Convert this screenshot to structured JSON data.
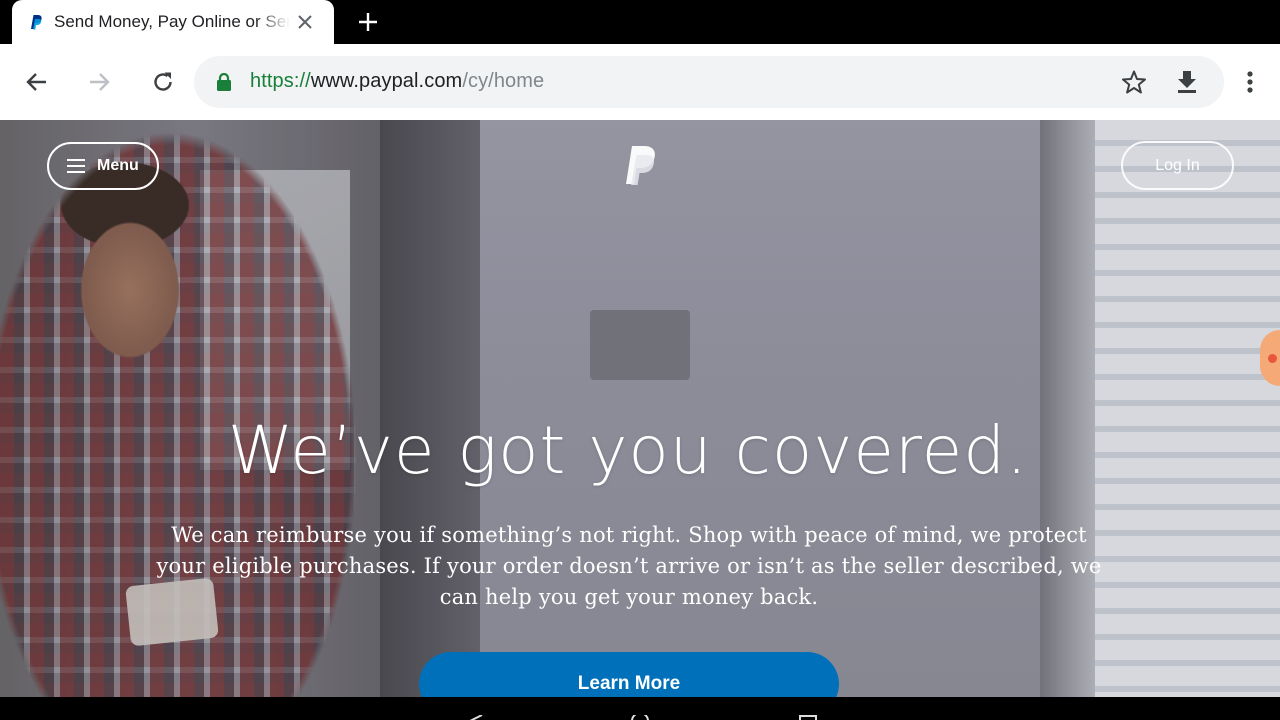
{
  "tab": {
    "title": "Send Money, Pay Online or Send Money",
    "favicon": "paypal-favicon"
  },
  "toolbar": {
    "url_scheme": "https://",
    "url_host": "www.paypal.com",
    "url_path": "/cy/home"
  },
  "icons": {
    "back": "back-arrow-icon",
    "forward": "forward-arrow-icon",
    "reload": "reload-icon",
    "lock": "lock-icon",
    "bookmark": "star-icon",
    "download": "download-icon",
    "more": "more-vert-icon",
    "close": "close-icon",
    "new_tab": "plus-icon"
  },
  "hero": {
    "menu_label": "Menu",
    "login_label": "Log In",
    "headline": "We’ve got you covered.",
    "body": "We can reimburse you if something’s not right. Shop with peace of mind, we protect your eligible purchases. If your order doesn’t arrive or isn’t as the seller described, we can help you get your money back.",
    "cta_label": "Learn More"
  },
  "colors": {
    "paypal_blue": "#0070ba",
    "secure_green": "#188038",
    "omnibox_bg": "#f1f3f4"
  }
}
